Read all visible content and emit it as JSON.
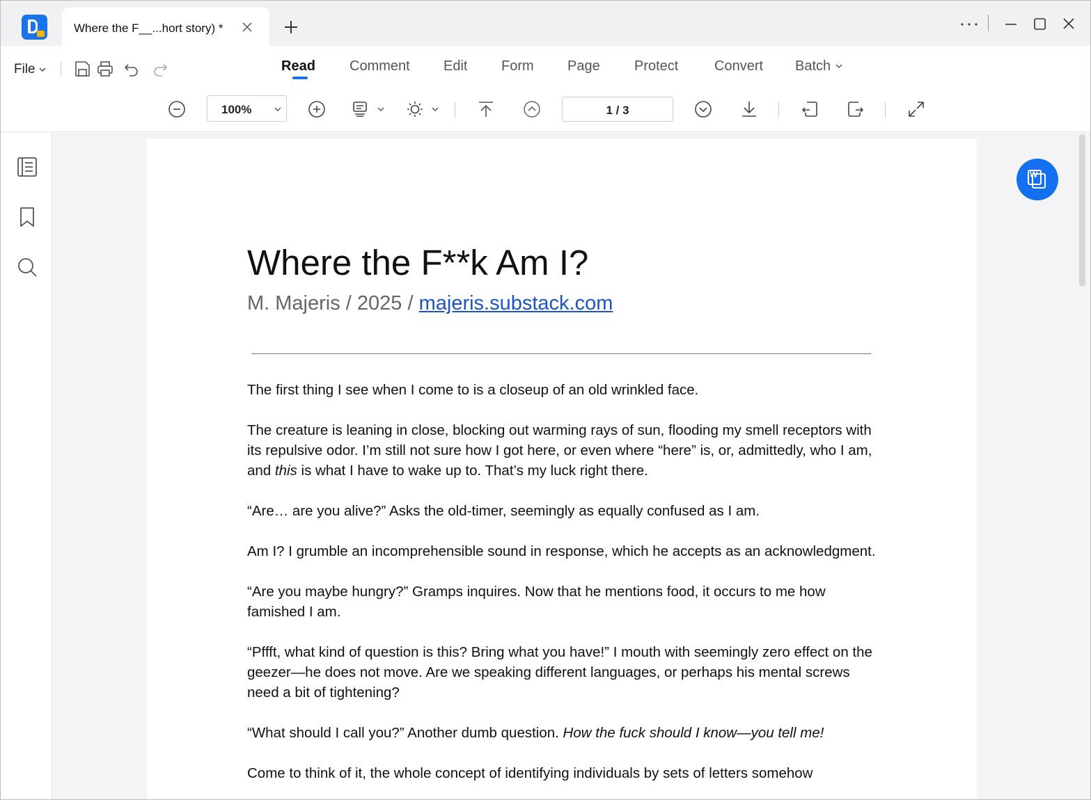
{
  "titlebar": {
    "tab_title": "Where the F__...hort story) *"
  },
  "menubar": {
    "file_label": "File",
    "tabs": [
      {
        "label": "Read",
        "active": true
      },
      {
        "label": "Comment"
      },
      {
        "label": "Edit"
      },
      {
        "label": "Form"
      },
      {
        "label": "Page"
      },
      {
        "label": "Protect"
      },
      {
        "label": "Convert"
      },
      {
        "label": "Batch"
      }
    ]
  },
  "toolbar": {
    "zoom": "100%",
    "page_indicator": "1  / 3"
  },
  "document": {
    "title": "Where the F**k Am I?",
    "byline_prefix": "M. Majeris / 2025 / ",
    "byline_link": "majeris.substack.com",
    "paragraphs": [
      {
        "text": "The first thing I see when I come to is a closeup of an old wrinkled face."
      },
      {
        "before": "The creature is leaning in close, blocking out warming rays of sun, flooding my smell receptors with its repulsive odor. I’m still not sure how I got here, or even where “here” is, or, admittedly, who I am, and ",
        "italic": "this",
        "after": " is what I have to wake up to. That’s my luck right there."
      },
      {
        "text": "“Are… are you alive?” Asks the old-timer, seemingly as equally confused as I am."
      },
      {
        "text": "Am I? I grumble an incomprehensible sound in response, which he accepts as an acknowledgment."
      },
      {
        "text": "“Are you maybe hungry?” Gramps inquires. Now that he mentions food, it occurs to me how famished I am."
      },
      {
        "text": "“Pffft, what kind of question is this? Bring what you have!” I mouth with seemingly zero effect on the geezer—he does not move. Are we speaking different languages, or perhaps his mental screws need a bit of tightening?"
      },
      {
        "before": "“What should I call you?” Another dumb question. ",
        "italic": "How the fuck should I know—you tell me!",
        "after": ""
      },
      {
        "text": "Come to think of it, the whole concept of identifying individuals by sets of letters somehow"
      }
    ]
  },
  "colors": {
    "accent": "#1a73e8",
    "titlebar_bg": "#f1f1f3",
    "canvas_bg": "#f4f4f6",
    "link": "#1a55c8"
  },
  "icons": [
    "app-logo-icon",
    "close-icon",
    "plus-icon",
    "more-icon",
    "minimize-icon",
    "maximize-icon",
    "window-close-icon",
    "save-icon",
    "print-icon",
    "undo-icon",
    "redo-icon",
    "zoom-out-icon",
    "zoom-in-icon",
    "layout-icon",
    "brightness-icon",
    "first-page-icon",
    "previous-page-icon",
    "next-page-icon",
    "last-page-icon",
    "rotate-left-icon",
    "rotate-right-icon",
    "fullscreen-icon",
    "outline-icon",
    "bookmark-icon",
    "search-icon",
    "word-convert-icon"
  ]
}
